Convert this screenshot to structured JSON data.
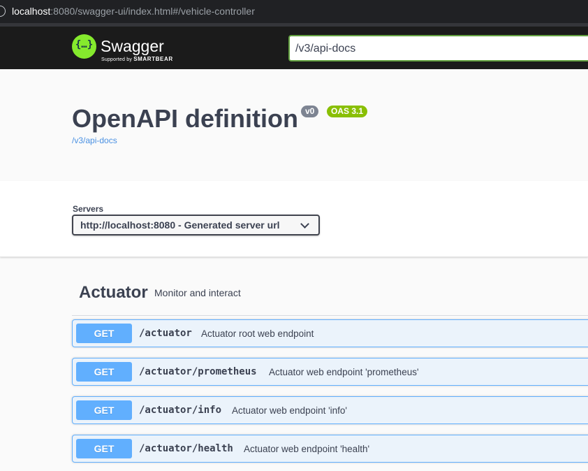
{
  "browser": {
    "url_host": "localhost",
    "url_rest": ":8080/swagger-ui/index.html#/vehicle-controller"
  },
  "topbar": {
    "logo_title": "Swagger",
    "logo_sub_prefix": "Supported by",
    "logo_sub_brand": "SMARTBEAR",
    "logo_glyph": "{…}",
    "search_value": "/v3/api-docs",
    "accent": "#85ea2d"
  },
  "info": {
    "title": "OpenAPI definition",
    "version_badge": "v0",
    "oas_badge": "OAS 3.1",
    "spec_link": "/v3/api-docs"
  },
  "servers": {
    "label": "Servers",
    "selected": "http://localhost:8080 - Generated server url"
  },
  "tag": {
    "name": "Actuator",
    "description": "Monitor and interact"
  },
  "operations": [
    {
      "method": "GET",
      "path": "/actuator",
      "summary": "Actuator root web endpoint"
    },
    {
      "method": "GET",
      "path": "/actuator/prometheus",
      "summary": "Actuator web endpoint 'prometheus'"
    },
    {
      "method": "GET",
      "path": "/actuator/info",
      "summary": "Actuator web endpoint 'info'"
    },
    {
      "method": "GET",
      "path": "/actuator/health",
      "summary": "Actuator web endpoint 'health'"
    }
  ],
  "colors": {
    "get_method": "#61affe",
    "get_bg": "#ebf3fb",
    "oas_badge": "#89bf04",
    "version_badge": "#7d8492",
    "link": "#4990e2"
  }
}
